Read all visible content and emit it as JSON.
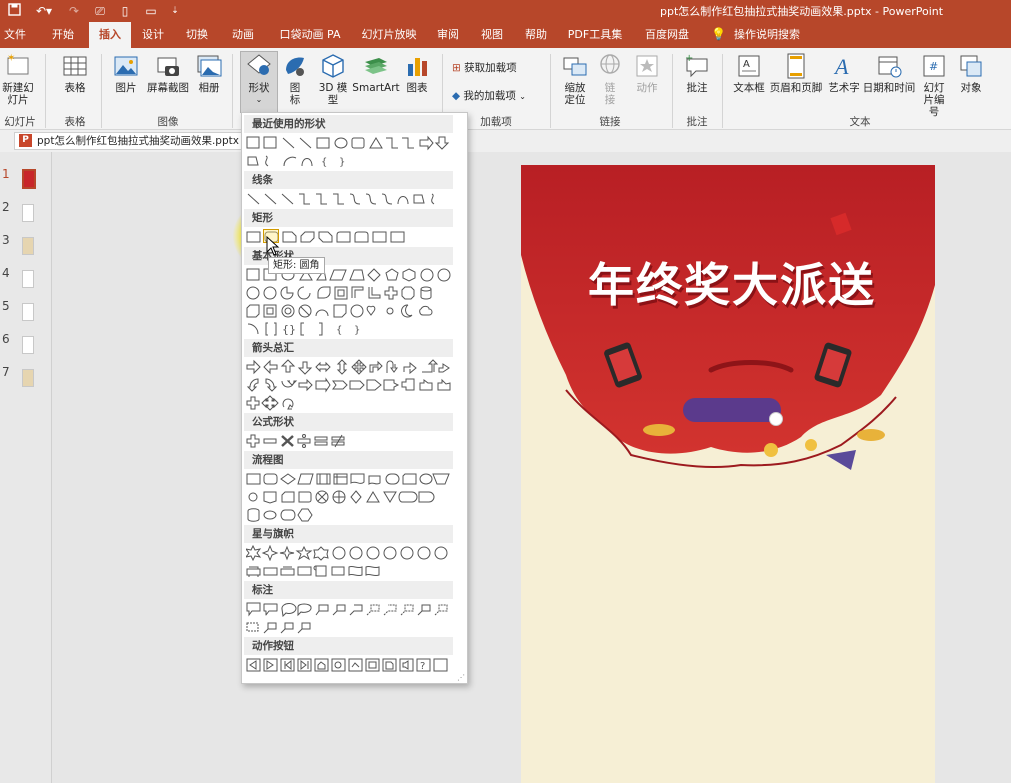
{
  "window": {
    "title": "ppt怎么制作红包抽拉式抽奖动画效果.pptx  -  PowerPoint"
  },
  "tabs": [
    "文件",
    "开始",
    "插入",
    "设计",
    "切换",
    "动画",
    "口袋动画 PA",
    "幻灯片放映",
    "审阅",
    "视图",
    "帮助",
    "PDF工具集",
    "百度网盘"
  ],
  "active_tab": "插入",
  "tell_me": "操作说明搜索",
  "ribbon": {
    "new_slide": "新建幻灯片",
    "table": "表格",
    "picture": "图片",
    "screenshot": "屏幕截图",
    "album": "相册",
    "shapes": "形状",
    "icons": "图标",
    "model3d": "3D 模型",
    "smartart": "SmartArt",
    "chart": "图表",
    "get_addins": "获取加载项",
    "my_addins": "我的加载项",
    "zoom": "缩放定位",
    "link": "链接",
    "action": "动作",
    "comment": "批注",
    "textbox": "文本框",
    "header_footer": "页眉和页脚",
    "wordart": "艺术字",
    "datetime": "日期和时间",
    "slide_number": "幻灯片编号",
    "object": "对象",
    "groups": {
      "slides": "幻灯片",
      "tables": "表格",
      "images": "图像",
      "addins": "加载项",
      "links": "链接",
      "comments": "批注",
      "text": "文本"
    }
  },
  "doc_tab": "ppt怎么制作红包抽拉式抽奖动画效果.pptx",
  "slide_numbers": [
    "1",
    "2",
    "3",
    "4",
    "5",
    "6",
    "7"
  ],
  "slide_title": "年终奖大派送",
  "shapes_menu": {
    "sections": [
      "最近使用的形状",
      "线条",
      "矩形",
      "基本形状",
      "箭头总汇",
      "公式形状",
      "流程图",
      "星与旗帜",
      "标注",
      "动作按钮"
    ],
    "tooltip": "矩形: 圆角"
  },
  "colors": {
    "accent": "#b7472a",
    "slide_red": "#c8262a",
    "slide_bg": "#f6efd5"
  }
}
